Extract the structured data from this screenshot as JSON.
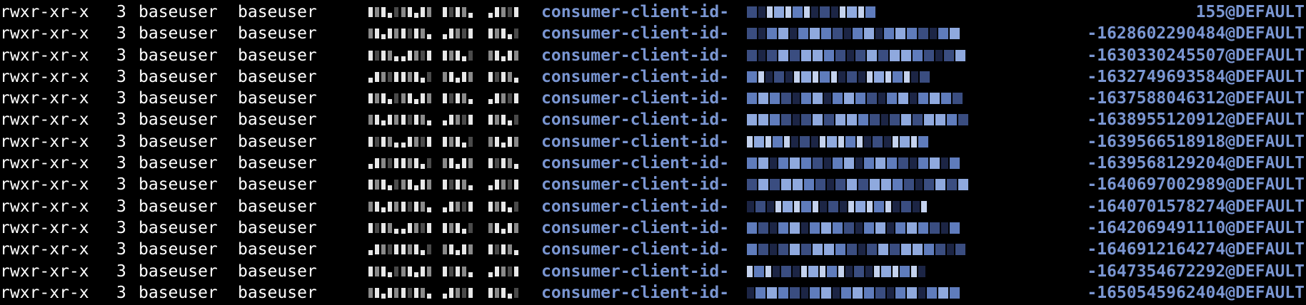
{
  "terminal": {
    "background": "#000000",
    "text_color": "#ffffff",
    "link_color": "#7a96d2",
    "rows": [
      {
        "perm": "rwxr-xr-x",
        "links": "3",
        "owner": "baseuser",
        "group": "baseuser",
        "name": "consumer-client-id-",
        "suffix": "155@DEFAULT"
      },
      {
        "perm": "rwxr-xr-x",
        "links": "3",
        "owner": "baseuser",
        "group": "baseuser",
        "name": "consumer-client-id-",
        "suffix": "-1628602290484@DEFAULT"
      },
      {
        "perm": "rwxr-xr-x",
        "links": "3",
        "owner": "baseuser",
        "group": "baseuser",
        "name": "consumer-client-id-",
        "suffix": "-1630330245507@DEFAULT"
      },
      {
        "perm": "rwxr-xr-x",
        "links": "3",
        "owner": "baseuser",
        "group": "baseuser",
        "name": "consumer-client-id-",
        "suffix": "-1632749693584@DEFAULT"
      },
      {
        "perm": "rwxr-xr-x",
        "links": "3",
        "owner": "baseuser",
        "group": "baseuser",
        "name": "consumer-client-id-",
        "suffix": "-1637588046312@DEFAULT"
      },
      {
        "perm": "rwxr-xr-x",
        "links": "3",
        "owner": "baseuser",
        "group": "baseuser",
        "name": "consumer-client-id-",
        "suffix": "-1638955120912@DEFAULT"
      },
      {
        "perm": "rwxr-xr-x",
        "links": "3",
        "owner": "baseuser",
        "group": "baseuser",
        "name": "consumer-client-id-",
        "suffix": "-1639566518918@DEFAULT"
      },
      {
        "perm": "rwxr-xr-x",
        "links": "3",
        "owner": "baseuser",
        "group": "baseuser",
        "name": "consumer-client-id-",
        "suffix": "-1639568129204@DEFAULT"
      },
      {
        "perm": "rwxr-xr-x",
        "links": "3",
        "owner": "baseuser",
        "group": "baseuser",
        "name": "consumer-client-id-",
        "suffix": "-1640697002989@DEFAULT"
      },
      {
        "perm": "rwxr-xr-x",
        "links": "3",
        "owner": "baseuser",
        "group": "baseuser",
        "name": "consumer-client-id-",
        "suffix": "-1640701578274@DEFAULT"
      },
      {
        "perm": "rwxr-xr-x",
        "links": "3",
        "owner": "baseuser",
        "group": "baseuser",
        "name": "consumer-client-id-",
        "suffix": "-1642069491110@DEFAULT"
      },
      {
        "perm": "rwxr-xr-x",
        "links": "3",
        "owner": "baseuser",
        "group": "baseuser",
        "name": "consumer-client-id-",
        "suffix": "-1646912164274@DEFAULT"
      },
      {
        "perm": "rwxr-xr-x",
        "links": "3",
        "owner": "baseuser",
        "group": "baseuser",
        "name": "consumer-client-id-",
        "suffix": "-1647354672292@DEFAULT"
      },
      {
        "perm": "rwxr-xr-x",
        "links": "3",
        "owner": "baseuser",
        "group": "baseuser",
        "name": "consumer-client-id-",
        "suffix": "-1650545962404@DEFAULT"
      }
    ]
  }
}
